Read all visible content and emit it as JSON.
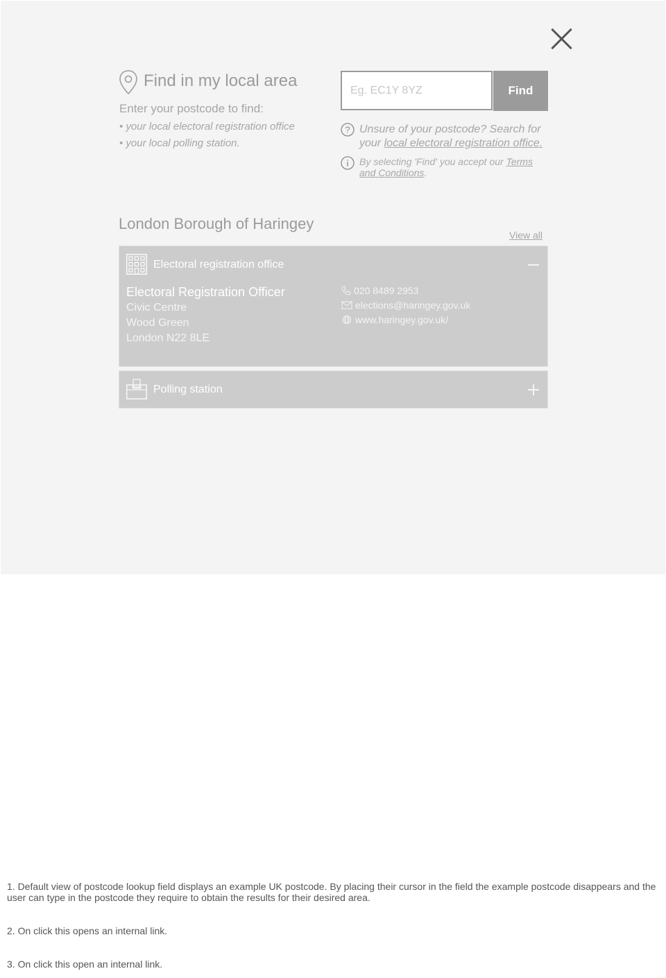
{
  "header": {
    "close_icon": "close-icon"
  },
  "intro": {
    "title": "Find in my local area",
    "subtitle": "Enter your postcode to find:",
    "bullets": [
      "• your local electoral registration office",
      "• your local polling station."
    ]
  },
  "search": {
    "placeholder": "Eg. EC1Y 8YZ",
    "value": "",
    "button_label": "Find"
  },
  "help": {
    "prefix": "Unsure of your postcode? Search for your ",
    "link": "local electoral registration office."
  },
  "terms": {
    "prefix": "By selecting 'Find' you accept our ",
    "link": "Terms and Conditions",
    "suffix": "."
  },
  "results": {
    "area_name": "London Borough of Haringey",
    "view_all": "View all",
    "office": {
      "title": "Electoral registration office",
      "toggle": "collapse",
      "name": "Electoral Registration Officer",
      "address": [
        "Civic Centre",
        "Wood Green",
        "London N22 8LE"
      ],
      "phone": "020 8489 2953",
      "email": "elections@haringey.gov.uk",
      "website": "www.haringey.gov.uk/"
    },
    "polling": {
      "title": "Polling station",
      "toggle": "expand"
    }
  },
  "notes": [
    "1. Default view of postcode lookup field displays an example UK postcode. By placing their cursor in the field the example postcode disappears and the user can type in the postcode they require to obtain the results for their desired area.",
    "2. On click this opens an internal link.",
    "3. On click this open an internal link."
  ],
  "colors": {
    "panel_bg": "#f4f4f4",
    "accordion_bg": "#cccccc",
    "button_bg": "#9b9b9b",
    "text_grey": "#a6a6a6"
  }
}
